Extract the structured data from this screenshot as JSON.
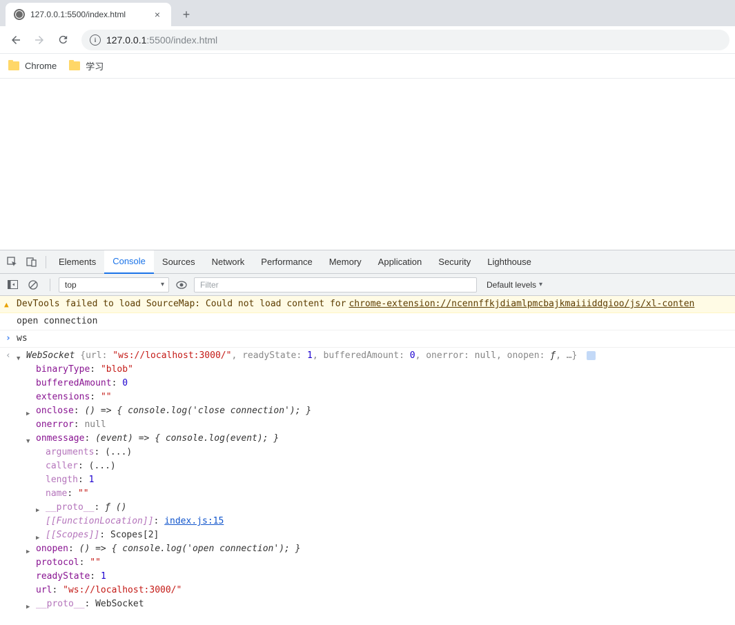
{
  "browser": {
    "tab_title": "127.0.0.1:5500/index.html",
    "url_host": "127.0.0.1",
    "url_port_path": ":5500/index.html",
    "bookmarks": [
      {
        "label": "Chrome"
      },
      {
        "label": "学习"
      }
    ]
  },
  "devtools": {
    "tabs": [
      "Elements",
      "Console",
      "Sources",
      "Network",
      "Performance",
      "Memory",
      "Application",
      "Security",
      "Lighthouse"
    ],
    "active_tab": "Console",
    "context": "top",
    "filter_placeholder": "Filter",
    "levels_label": "Default levels",
    "warning": {
      "prefix": "DevTools failed to load SourceMap: Could not load content for ",
      "link": "chrome-extension://ncennffkjdiamlpmcbajkmaiiiddgioo/js/xl-conten"
    },
    "log1": "open connection",
    "input1": "ws",
    "websocket": {
      "class": "WebSocket",
      "summary_url": "\"ws://localhost:3000/\"",
      "summary_readyState": "1",
      "summary_bufferedAmount": "0",
      "summary_onerror": "null",
      "summary_onopen": "ƒ",
      "binaryType": "\"blob\"",
      "bufferedAmount": "0",
      "extensions": "\"\"",
      "onclose": "() => { console.log('close connection'); }",
      "onerror": "null",
      "onmessage": "(event) => { console.log(event); }",
      "onmessage_arguments": "(...)",
      "onmessage_caller": "(...)",
      "onmessage_length": "1",
      "onmessage_name": "\"\"",
      "onmessage_proto": "ƒ ()",
      "onmessage_funcloc_label": "[[FunctionLocation]]",
      "onmessage_funcloc_link": "index.js:15",
      "onmessage_scopes_label": "[[Scopes]]",
      "onmessage_scopes_val": "Scopes[2]",
      "onopen": "() => { console.log('open connection'); }",
      "protocol": "\"\"",
      "readyState": "1",
      "url": "\"ws://localhost:3000/\"",
      "proto": "WebSocket"
    }
  }
}
